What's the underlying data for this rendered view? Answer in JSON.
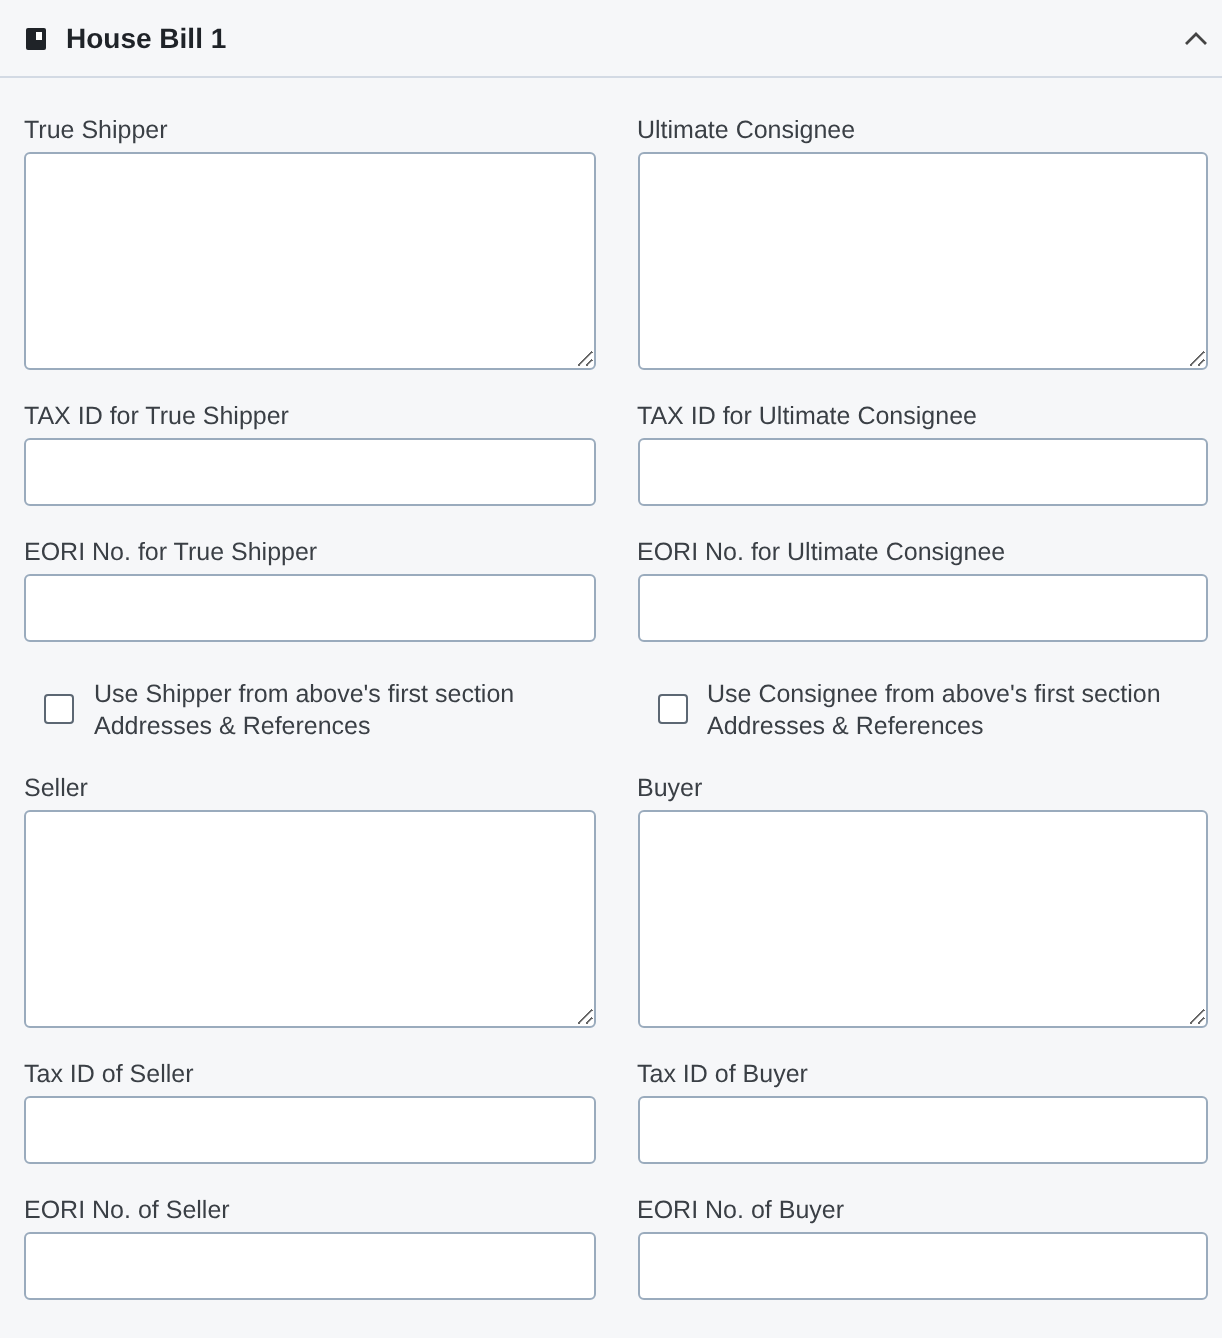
{
  "panel": {
    "title": "House Bill 1",
    "expanded": true
  },
  "fields": [
    {
      "kind": "textarea",
      "label": "True Shipper"
    },
    {
      "kind": "textarea",
      "label": "Ultimate Consignee"
    },
    {
      "kind": "input",
      "label": "TAX ID for True Shipper"
    },
    {
      "kind": "input",
      "label": "TAX ID for Ultimate Consignee"
    },
    {
      "kind": "input",
      "label": "EORI No. for True Shipper"
    },
    {
      "kind": "input",
      "label": "EORI No. for Ultimate Consignee"
    },
    {
      "kind": "checkbox",
      "label": "Use Shipper from above's first section Addresses & References",
      "checked": false
    },
    {
      "kind": "checkbox",
      "label": "Use Consignee from above's first section Addresses & References",
      "checked": false
    },
    {
      "kind": "textarea",
      "label": "Seller"
    },
    {
      "kind": "textarea",
      "label": "Buyer"
    },
    {
      "kind": "input",
      "label": "Tax ID of Seller"
    },
    {
      "kind": "input",
      "label": "Tax ID of Buyer"
    },
    {
      "kind": "input",
      "label": "EORI No. of Seller"
    },
    {
      "kind": "input",
      "label": "EORI No. of Buyer"
    }
  ]
}
